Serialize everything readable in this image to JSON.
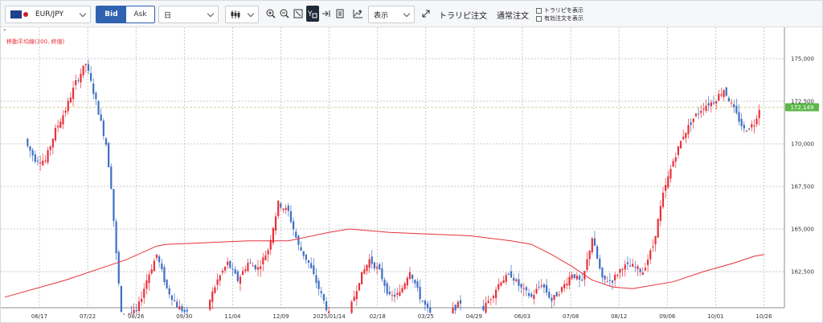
{
  "toolbar": {
    "currency_pair": "EUR/JPY",
    "bid_label": "Bid",
    "ask_label": "Ask",
    "period": "日",
    "display_label": "表示",
    "trailing_order_label": "トラリピ注文",
    "normal_order_label": "通常注文",
    "show_trailing_label": "トラリピを表示",
    "show_active_orders_label": "有効注文を表示"
  },
  "indicator": {
    "label": "移動平均線(200, 終値)",
    "color": "#e8303a"
  },
  "colors": {
    "up": "#e8303a",
    "down": "#3f6fc4",
    "current_price_badge": "#5cb84a",
    "accent": "#2f62b0"
  },
  "chart_data": {
    "type": "candlestick",
    "y_ticks": [
      "162,500",
      "165,000",
      "167,500",
      "170,000",
      "172,500",
      "175,000"
    ],
    "y_values": [
      162.5,
      165.0,
      167.5,
      170.0,
      172.5,
      175.0
    ],
    "x_ticks": [
      "06/17",
      "07/22",
      "08/26",
      "09/30",
      "11/04",
      "12/09",
      "2025/01/14",
      "02/18",
      "03/25",
      "04/29",
      "06/03",
      "07/08",
      "08/12",
      "09/06",
      "10/01",
      "10/26"
    ],
    "current_price": "172,149",
    "current_price_value": 172.149,
    "ylim": [
      160.0,
      177.4
    ],
    "moving_average": {
      "name": "移動平均線(200, 終値)",
      "points": [
        [
          0,
          161.0
        ],
        [
          6,
          162.0
        ],
        [
          12,
          163.2
        ],
        [
          15,
          164.0
        ],
        [
          16,
          164.1
        ],
        [
          24,
          164.3
        ],
        [
          28,
          164.3
        ],
        [
          32,
          164.8
        ],
        [
          34,
          165.0
        ],
        [
          38,
          164.8
        ],
        [
          42,
          164.7
        ],
        [
          46,
          164.6
        ],
        [
          50,
          164.3
        ],
        [
          52,
          164.1
        ],
        [
          54,
          163.5
        ],
        [
          56,
          162.8
        ],
        [
          58,
          162.0
        ],
        [
          60,
          161.6
        ],
        [
          62,
          161.5
        ],
        [
          66,
          161.9
        ],
        [
          69,
          162.5
        ],
        [
          72,
          163.0
        ],
        [
          74,
          163.4
        ],
        [
          75,
          163.5
        ]
      ]
    },
    "segments": [
      [
        0,
        170.3
      ],
      [
        2,
        170.1
      ],
      [
        3,
        169.1
      ],
      [
        4,
        169.0
      ],
      [
        5,
        170.8
      ],
      [
        6,
        172.0
      ],
      [
        7,
        173.6
      ],
      [
        8,
        174.7
      ],
      [
        9,
        172.5
      ],
      [
        10,
        170.0
      ],
      [
        10.5,
        167.5
      ],
      [
        11,
        163.5
      ],
      [
        11.5,
        160.0
      ],
      [
        13,
        160.1
      ],
      [
        14,
        162.0
      ],
      [
        15,
        163.5
      ],
      [
        16,
        161.5
      ],
      [
        17,
        160.5
      ],
      [
        18,
        160.0
      ],
      [
        20,
        160.5
      ],
      [
        21,
        162.0
      ],
      [
        22,
        163.0
      ],
      [
        23,
        162.0
      ],
      [
        24,
        163.0
      ],
      [
        25,
        162.7
      ],
      [
        26,
        163.8
      ],
      [
        27,
        166.5
      ],
      [
        28,
        166.0
      ],
      [
        29,
        164.0
      ],
      [
        30,
        163.0
      ],
      [
        31,
        161.5
      ],
      [
        32,
        160.0
      ],
      [
        34,
        160.1
      ],
      [
        35,
        162.0
      ],
      [
        36,
        163.2
      ],
      [
        37,
        162.5
      ],
      [
        38,
        161.0
      ],
      [
        39,
        161.2
      ],
      [
        40,
        162.6
      ],
      [
        41,
        161.0
      ],
      [
        42,
        160.0
      ],
      [
        44,
        160.1
      ],
      [
        45,
        160.7
      ],
      [
        47,
        160.1
      ],
      [
        48,
        161.0
      ],
      [
        49,
        162.0
      ],
      [
        50,
        162.3
      ],
      [
        51,
        161.5
      ],
      [
        52,
        161.0
      ],
      [
        53,
        161.8
      ],
      [
        54,
        160.8
      ],
      [
        55,
        161.5
      ],
      [
        56,
        162.4
      ],
      [
        57,
        161.8
      ],
      [
        58,
        164.5
      ],
      [
        59,
        162.0
      ],
      [
        60,
        162.0
      ],
      [
        61,
        162.8
      ],
      [
        62,
        162.8
      ],
      [
        63,
        162.5
      ],
      [
        64,
        164.0
      ],
      [
        65,
        167.0
      ],
      [
        66,
        169.0
      ],
      [
        67,
        170.5
      ],
      [
        68,
        171.5
      ],
      [
        69,
        172.2
      ],
      [
        70,
        172.5
      ],
      [
        71,
        173.2
      ],
      [
        72,
        172.0
      ],
      [
        73,
        170.8
      ],
      [
        74,
        171.2
      ],
      [
        74.5,
        172.1
      ]
    ]
  }
}
